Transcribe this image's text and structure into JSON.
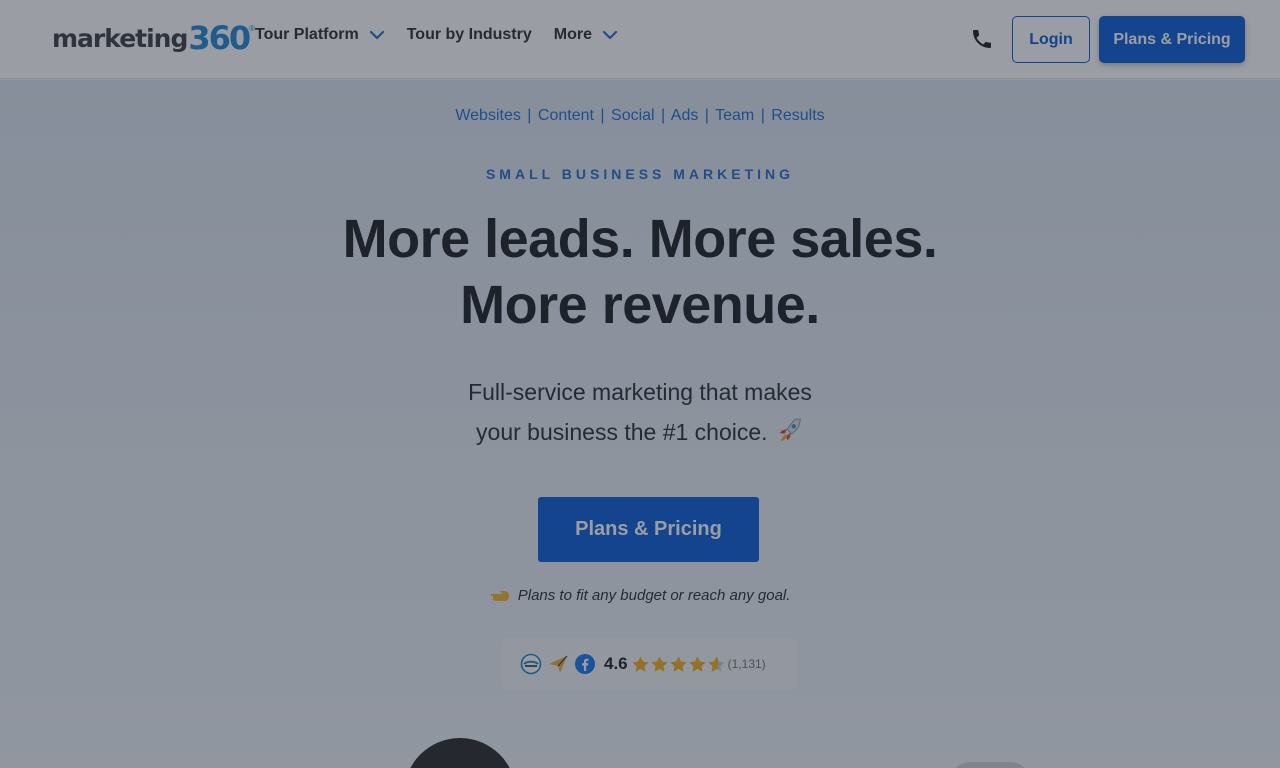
{
  "header": {
    "logo": {
      "word": "marketing",
      "number": "360",
      "reg": "®"
    },
    "nav": [
      {
        "label": "Tour Platform",
        "has_dropdown": true
      },
      {
        "label": "Tour by Industry",
        "has_dropdown": false
      },
      {
        "label": "More",
        "has_dropdown": true
      }
    ],
    "login_label": "Login",
    "plans_label": "Plans & Pricing"
  },
  "hero": {
    "subnav": [
      "Websites",
      "Content",
      "Social",
      "Ads",
      "Team",
      "Results"
    ],
    "subnav_separator": "|",
    "eyebrow": "SMALL BUSINESS MARKETING",
    "headline_line1": "More leads. More sales.",
    "headline_line2": "More revenue.",
    "lead_line1": "Full-service marketing that makes",
    "lead_line2": "your business the #1 choice.",
    "cta_label": "Plans & Pricing",
    "note": "Plans to fit any budget or reach any goal."
  },
  "rating": {
    "score": "4.6",
    "stars": 4.6,
    "count": "(1,131)"
  },
  "colors": {
    "accent": "#0b5ed7",
    "link": "#1f6fd0",
    "star": "#f2b01e",
    "overlay": "rgba(30,38,52,0.45)"
  }
}
